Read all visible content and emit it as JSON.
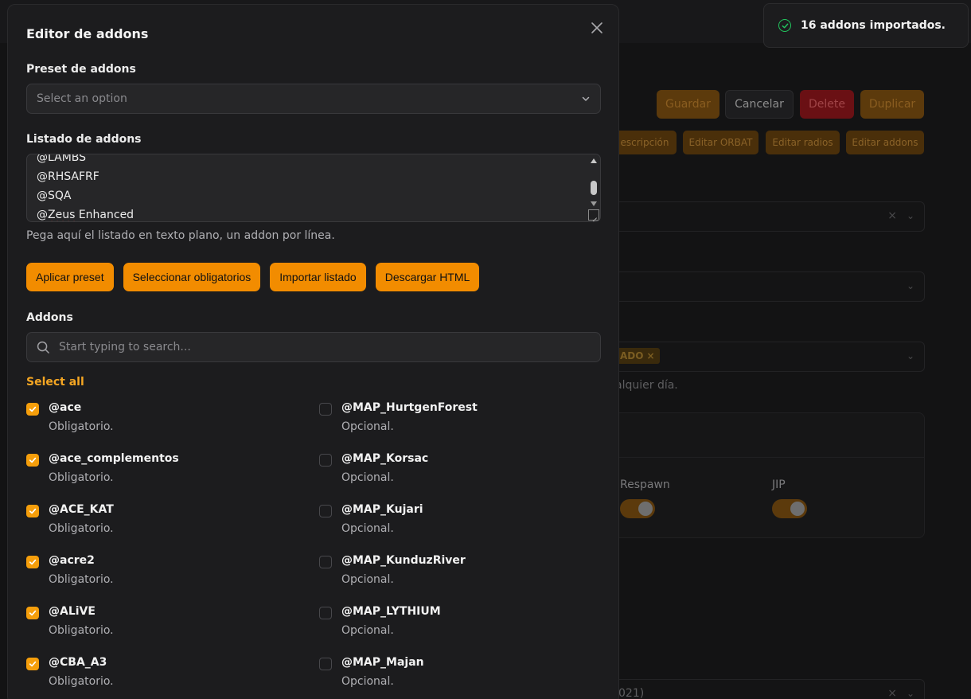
{
  "background": {
    "buttons": {
      "save": "Guardar",
      "cancel": "Cancelar",
      "delete": "Delete",
      "duplicate": "Duplicar"
    },
    "small_buttons": [
      "escripción",
      "Editar ORBAT",
      "Editar radios",
      "Editar addons"
    ],
    "chip_label": "ADO",
    "hint_fragment": "alquier día.",
    "toggle_labels": [
      "Respawn",
      "JIP"
    ],
    "bottom_fragment": "021)"
  },
  "toast": {
    "message": "16 addons importados.",
    "icon": "check-circle-icon",
    "color": "#22c55e"
  },
  "modal": {
    "title": "Editor de addons",
    "close_icon": "close-icon",
    "preset": {
      "label": "Preset de addons",
      "placeholder": "Select an option"
    },
    "list": {
      "label": "Listado de addons",
      "lines": [
        "@LAMBS",
        "@RHSAFRF",
        "@SQA",
        "@Zeus Enhanced"
      ],
      "help": "Pega aquí el listado en texto plano, un addon por línea."
    },
    "actions": [
      "Aplicar preset",
      "Seleccionar obligatorios",
      "Importar listado",
      "Descargar HTML"
    ],
    "addons_label": "Addons",
    "search_placeholder": "Start typing to search...",
    "select_all": "Select all",
    "addons": [
      {
        "name": "@ace",
        "desc": "Obligatorio.",
        "checked": true
      },
      {
        "name": "@MAP_HurtgenForest",
        "desc": "Opcional.",
        "checked": false
      },
      {
        "name": "@ace_complementos",
        "desc": "Obligatorio.",
        "checked": true
      },
      {
        "name": "@MAP_Korsac",
        "desc": "Opcional.",
        "checked": false
      },
      {
        "name": "@ACE_KAT",
        "desc": "Obligatorio.",
        "checked": true
      },
      {
        "name": "@MAP_Kujari",
        "desc": "Opcional.",
        "checked": false
      },
      {
        "name": "@acre2",
        "desc": "Obligatorio.",
        "checked": true
      },
      {
        "name": "@MAP_KunduzRiver",
        "desc": "Opcional.",
        "checked": false
      },
      {
        "name": "@ALiVE",
        "desc": "Obligatorio.",
        "checked": true
      },
      {
        "name": "@MAP_LYTHIUM",
        "desc": "Opcional.",
        "checked": false
      },
      {
        "name": "@CBA_A3",
        "desc": "Obligatorio.",
        "checked": true
      },
      {
        "name": "@MAP_Majan",
        "desc": "Opcional.",
        "checked": false
      }
    ],
    "accent_color": "#f28c00"
  }
}
